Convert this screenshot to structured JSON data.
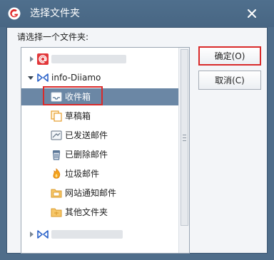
{
  "window": {
    "title": "选择文件夹",
    "close_glyph": "×"
  },
  "prompt": "请选择一个文件夹:",
  "tree": {
    "accounts": [
      {
        "icon": "at-mail-icon",
        "label": "",
        "expanded": false
      },
      {
        "icon": "m365-logo-icon",
        "label": "info-Diiamo",
        "expanded": true,
        "folders": [
          {
            "icon": "inbox-icon",
            "label": "收件箱",
            "selected": true
          },
          {
            "icon": "drafts-icon",
            "label": "草稿箱"
          },
          {
            "icon": "sent-icon",
            "label": "已发送邮件"
          },
          {
            "icon": "trash-icon",
            "label": "已删除邮件"
          },
          {
            "icon": "junk-icon",
            "label": "垃圾邮件"
          },
          {
            "icon": "notification-folder-icon",
            "label": "网站通知邮件"
          },
          {
            "icon": "folder-icon",
            "label": "其他文件夹"
          }
        ]
      },
      {
        "icon": "m365-logo-icon",
        "label": "",
        "expanded": false
      }
    ]
  },
  "buttons": {
    "ok": "确定(O)",
    "cancel": "取消(C)"
  },
  "colors": {
    "titlebar": "#4f6f8d",
    "selection": "#6b87a5",
    "highlight": "#d92a2a"
  }
}
